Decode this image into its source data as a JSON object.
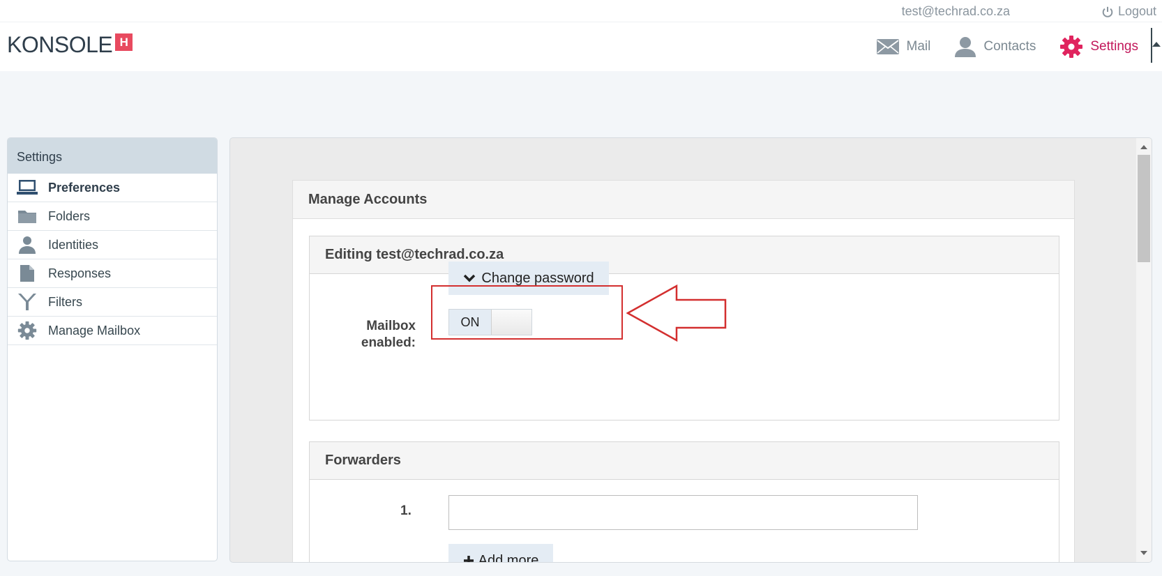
{
  "top": {
    "user_email": "test@techrad.co.za",
    "logout_label": "Logout"
  },
  "header": {
    "logo_text": "KONSOLE",
    "logo_badge": "H",
    "nav": [
      {
        "label": "Mail",
        "icon": "mail-icon"
      },
      {
        "label": "Contacts",
        "icon": "contacts-icon"
      },
      {
        "label": "Settings",
        "icon": "settings-gear-icon",
        "active": true
      }
    ]
  },
  "sidebar": {
    "title": "Settings",
    "items": [
      {
        "label": "Preferences",
        "icon": "laptop-icon",
        "selected": true
      },
      {
        "label": "Folders",
        "icon": "folder-icon"
      },
      {
        "label": "Identities",
        "icon": "person-icon"
      },
      {
        "label": "Responses",
        "icon": "document-icon"
      },
      {
        "label": "Filters",
        "icon": "filter-icon"
      },
      {
        "label": "Manage Mailbox",
        "icon": "gear-icon"
      }
    ]
  },
  "main": {
    "card_title": "Manage Accounts",
    "editing_title": "Editing test@techrad.co.za",
    "change_password_label": "Change password",
    "mailbox_enabled_label": "Mailbox enabled:",
    "toggle_state": "ON",
    "forwarders_title": "Forwarders",
    "forwarder_rows": [
      {
        "number": "1.",
        "value": ""
      }
    ],
    "add_more_label": "Add more"
  },
  "colors": {
    "accent": "#c2185b",
    "annotation": "#d32f2f",
    "button_bg": "#e4ecf4"
  }
}
